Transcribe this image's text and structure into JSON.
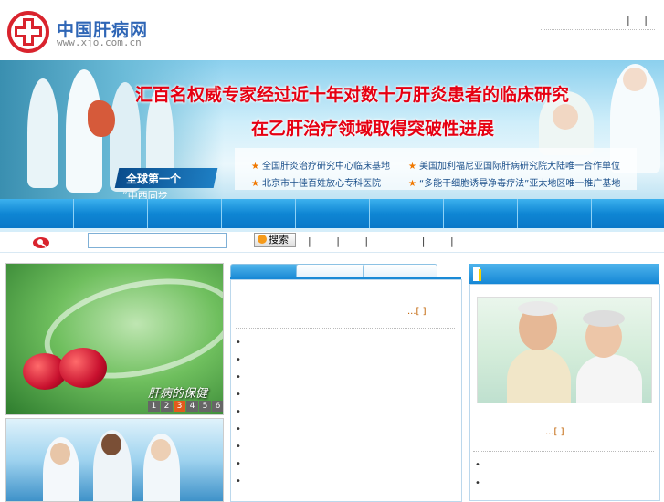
{
  "header": {
    "site_name": "中国肝病网",
    "site_url": "www.xjo.com.cn",
    "top_links": "| |"
  },
  "banner": {
    "title_line1": "汇百名权威专家经过近十年对数十万肝炎患者的临床研究",
    "title_line2": "在乙肝治疗领域取得突破性进展",
    "bullets": [
      "全国肝炎治疗研究中心临床基地",
      "美国加利福尼亚国际肝病研究院大陆唯一合作单位",
      "北京市十佳百姓放心专科医院",
      "“多能干细胞诱导净毒疗法”亚太地区唯一推广基地"
    ],
    "ribbon_text": "全球第一个",
    "ribbon_sub": "“中西同步"
  },
  "colors": {
    "brand_blue": "#2f66b6",
    "banner_red": "#e60012",
    "nav_blue": "#0f86d4",
    "accent_orange": "#e25a1c"
  },
  "search": {
    "input_value": "",
    "button_label": "搜索",
    "keyword_links": "| | | | | |"
  },
  "slideshow": {
    "caption": "肝病的保健",
    "numbers": [
      "1",
      "2",
      "3",
      "4",
      "5",
      "6"
    ],
    "active_index": 3
  },
  "middle": {
    "more_text": "...[ ]",
    "list_bullets": [
      "•",
      "•",
      "•",
      "•",
      "•",
      "•",
      "•",
      "•",
      "•"
    ]
  },
  "right": {
    "more_text": "...[ ]",
    "list_bullets": [
      "•",
      "•"
    ]
  }
}
